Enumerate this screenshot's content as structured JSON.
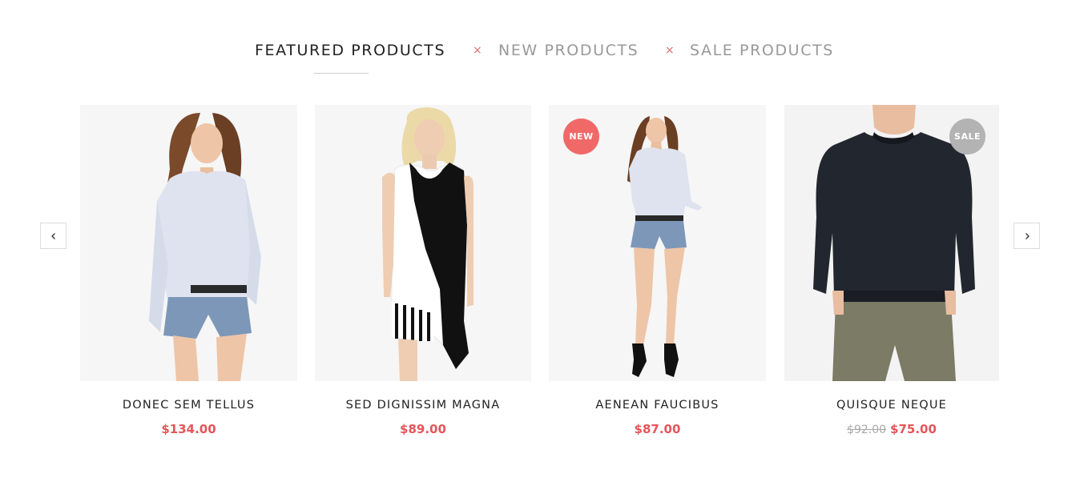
{
  "tabs": [
    {
      "label": "FEATURED PRODUCTS",
      "active": true
    },
    {
      "label": "NEW PRODUCTS",
      "active": false
    },
    {
      "label": "SALE PRODUCTS",
      "active": false
    }
  ],
  "tab_separator": "×",
  "nav": {
    "prev_icon": "chevron-left-icon",
    "next_icon": "chevron-right-icon"
  },
  "products": [
    {
      "name": "DONEC SEM TELLUS",
      "price": "$134.00",
      "old_price": "",
      "badge": ""
    },
    {
      "name": "SED DIGNISSIM MAGNA",
      "price": "$89.00",
      "old_price": "",
      "badge": ""
    },
    {
      "name": "AENEAN FAUCIBUS",
      "price": "$87.00",
      "old_price": "",
      "badge": "NEW"
    },
    {
      "name": "QUISQUE NEQUE",
      "price": "$75.00",
      "old_price": "$92.00",
      "badge": "SALE"
    }
  ],
  "colors": {
    "accent": "#e4555a",
    "badge_new": "#f06868",
    "badge_sale": "#b3b3b3",
    "tab_active": "#222222",
    "tab_inactive": "#999999"
  }
}
